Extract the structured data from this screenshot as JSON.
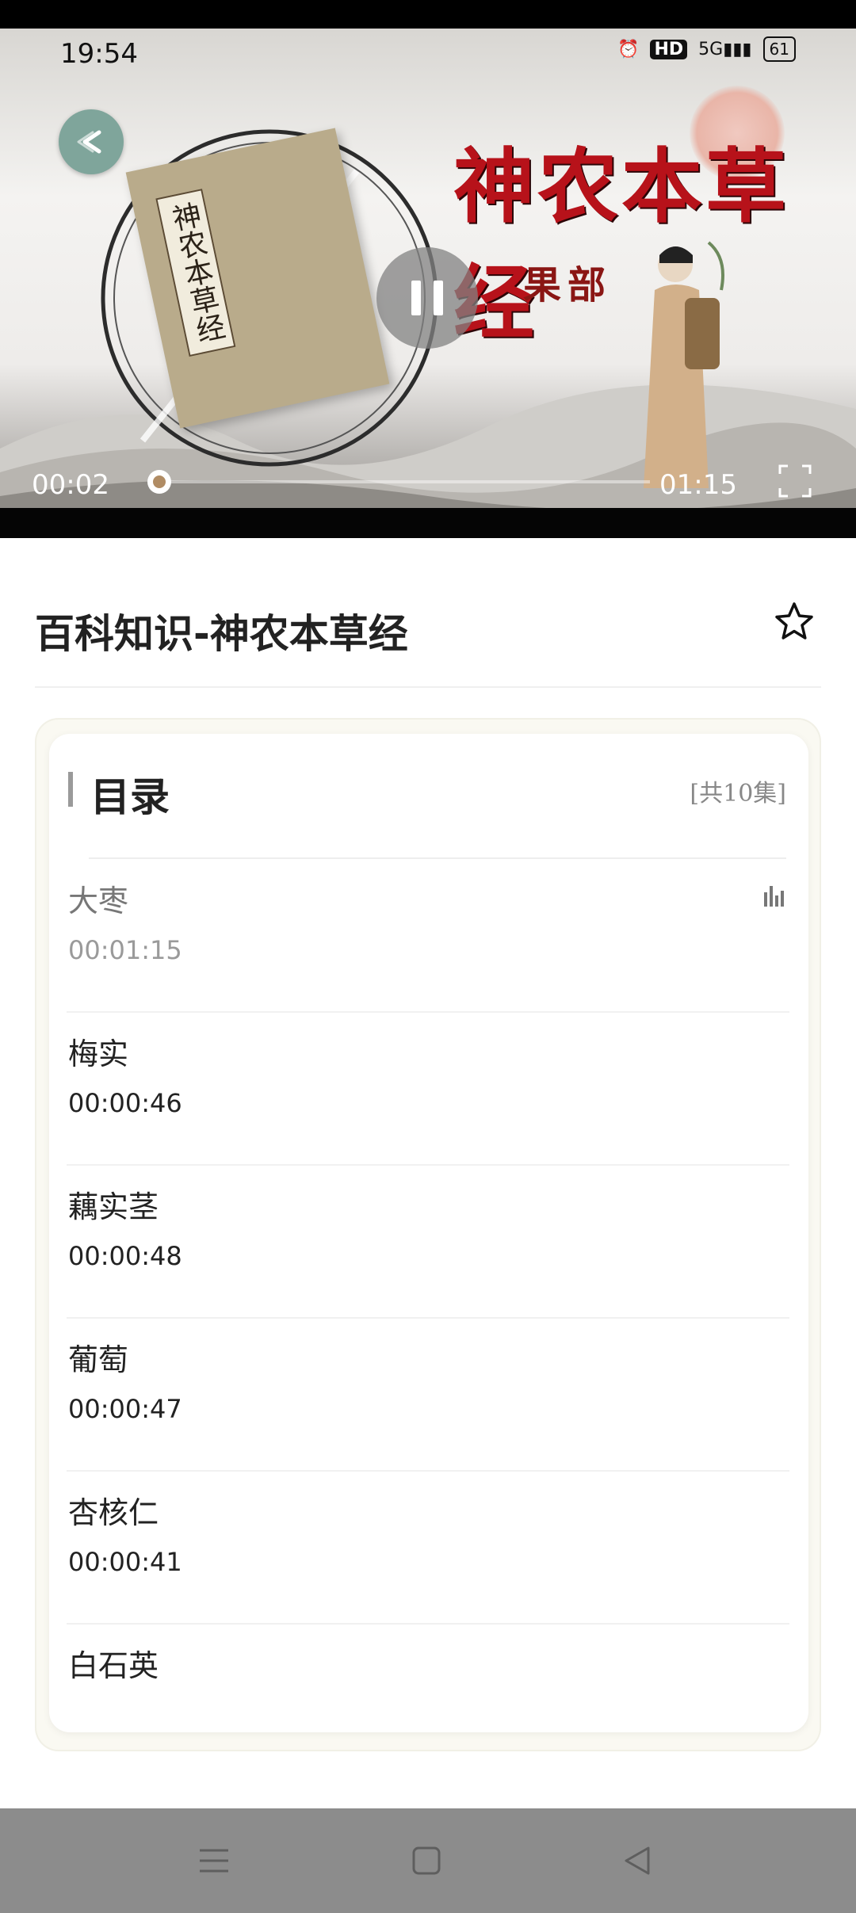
{
  "status_bar": {
    "time": "19:54",
    "hd_label": "HD",
    "network_label": "5G",
    "battery": "61"
  },
  "player": {
    "headline": "神农本草经",
    "subheadline": "果部",
    "book_label": "神农本草经",
    "current_time": "00:02",
    "total_time": "01:15",
    "progress": 0.03,
    "is_playing": true
  },
  "page": {
    "title": "百科知识-神农本草经"
  },
  "catalog": {
    "heading": "目录",
    "count_label": "[共10集]",
    "episodes": [
      {
        "name": "大枣",
        "duration": "00:01:15",
        "active": true
      },
      {
        "name": "梅实",
        "duration": "00:00:46",
        "active": false
      },
      {
        "name": "藕实茎",
        "duration": "00:00:48",
        "active": false
      },
      {
        "name": "葡萄",
        "duration": "00:00:47",
        "active": false
      },
      {
        "name": "杏核仁",
        "duration": "00:00:41",
        "active": false
      },
      {
        "name": "白石英",
        "duration": "",
        "active": false
      }
    ]
  },
  "colors": {
    "accent": "#7fa59b",
    "headline_red": "#b7121a",
    "nav_bar": "#8c8c8c"
  },
  "icons": {
    "back": "arrow-left-icon",
    "pause": "pause-icon",
    "fullscreen": "fullscreen-icon",
    "favorite": "star-icon",
    "playing": "equalizer-icon",
    "nav_menu": "menu-icon",
    "nav_home": "home-icon",
    "nav_back": "back-triangle-icon"
  }
}
